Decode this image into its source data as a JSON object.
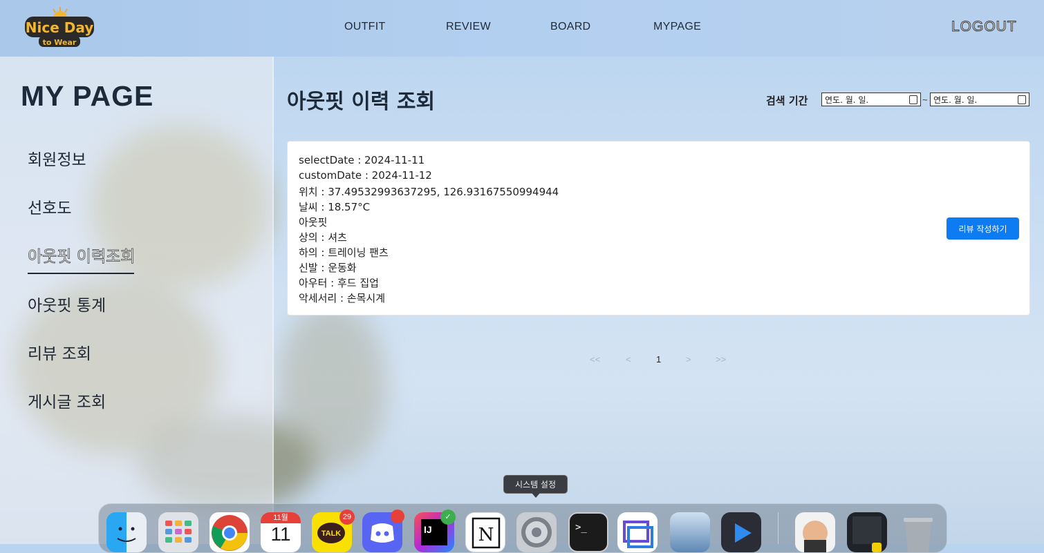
{
  "header": {
    "logo": {
      "line1": "Nice Day",
      "line2": "to Wear"
    },
    "nav": [
      "OUTFIT",
      "REVIEW",
      "BOARD",
      "MYPAGE"
    ],
    "logout": "LOGOUT"
  },
  "sidebar": {
    "title": "MY PAGE",
    "items": [
      {
        "label": "회원정보",
        "active": false
      },
      {
        "label": "선호도",
        "active": false
      },
      {
        "label": "아웃핏 이력조회",
        "active": true
      },
      {
        "label": "아웃핏 통계",
        "active": false
      },
      {
        "label": "리뷰 조회",
        "active": false
      },
      {
        "label": "게시글 조회",
        "active": false
      }
    ]
  },
  "main": {
    "title": "아웃핏 이력 조회",
    "search": {
      "label": "검색 기간",
      "start_placeholder": "연도. 월. 일.",
      "end_placeholder": "연도. 월. 일.",
      "separator": "~"
    },
    "record": {
      "lines": [
        "selectDate : 2024-11-11",
        "customDate : 2024-11-12",
        "위치 : 37.49532993637295, 126.93167550994944",
        "날씨 : 18.57°C",
        "아웃핏",
        "상의 : 셔츠",
        "하의 : 트레이닝 팬츠",
        "신발 : 운동화",
        "아우터 : 후드 집업",
        "악세서리 : 손목시계"
      ],
      "review_button": "리뷰 작성하기"
    },
    "pagination": {
      "first": "<<",
      "prev": "<",
      "current": "1",
      "next": ">",
      "last": ">>"
    }
  },
  "dock": {
    "tooltip": "시스템 설정",
    "calendar": {
      "month": "11월",
      "day": "11"
    },
    "kakao": {
      "label": "TALK",
      "badge": "29"
    },
    "intellij": {
      "label": "IJ"
    },
    "apps": [
      "finder-icon",
      "launchpad-icon",
      "chrome-icon",
      "calendar-icon",
      "kakaotalk-icon",
      "discord-icon",
      "intellij-icon",
      "notion-icon",
      "system-settings-icon",
      "terminal-icon",
      "preview-icon",
      "photos-icon",
      "video-player-icon",
      "jenkins-icon",
      "activity-icon",
      "trash-icon"
    ]
  },
  "colors": {
    "accent": "#0d7bf2",
    "text": "#1d2a3a"
  }
}
